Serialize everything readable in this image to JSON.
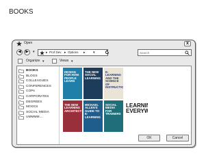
{
  "page": {
    "title": "BOOKS"
  },
  "dialog": {
    "title": "Open",
    "close_label": "x",
    "nav": {
      "back_label": "◀",
      "forward_label": "▶",
      "history_label": "▾",
      "path": [
        "Prof Dev",
        "Options"
      ],
      "search_placeholder": "Search"
    },
    "toolbar": {
      "organize_label": "Organize",
      "views_label": "Views"
    },
    "folders": [
      "BOOKS",
      "BLOGS",
      "COLLEAGUES",
      "CONFERENCES",
      "COPs",
      "CORPORATES",
      "DEGREES",
      "MOOCs",
      "SOCIAL MEDIA",
      "UMMMM...."
    ],
    "selected_folder": "BOOKS",
    "book_covers": [
      {
        "text": "DESIGN FOR HOW PEOPLE LEARN",
        "bg": "#1f7fa8",
        "fg": "#ffffff"
      },
      {
        "text": "THE NEW SOCIAL LEARNING",
        "bg": "#1d3b5a",
        "fg": "#ffffff"
      },
      {
        "text": "E-LEARNING AND THE SCIENCE OF INSTRUCTION",
        "bg": "#e9e4d6",
        "fg": "#2b3a67"
      },
      {
        "text": "THE NEW LEARNING ARCHITECT",
        "bg": "#9a2f3c",
        "fg": "#ffffff"
      },
      {
        "text": "MICHAEL ALLEN'S GUIDE TO E-LEARNING",
        "bg": "#1f5e8c",
        "fg": "#ffffff"
      },
      {
        "text": "SOCIAL MEDIA FOR TRAINERS",
        "bg": "#1f6f7a",
        "fg": "#ffffff"
      },
      {
        "text": "LEARNING EVERYWHERE",
        "bg": "#ffffff",
        "fg": "#111111"
      }
    ],
    "ok_label": "OK",
    "cancel_label": "Cancel"
  }
}
